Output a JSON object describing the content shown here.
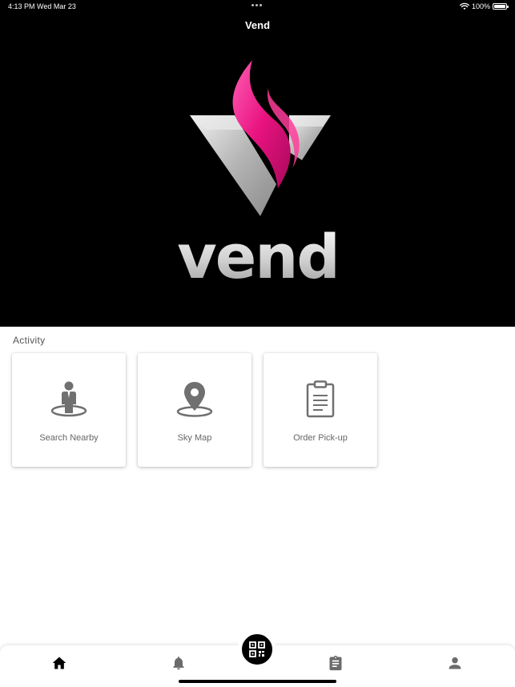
{
  "status_bar": {
    "time": "4:13 PM",
    "date": "Wed Mar 23",
    "battery": "100%",
    "battery_level": 1.0
  },
  "app": {
    "title": "Vend",
    "logo_text": "vend",
    "brand_colors": {
      "accent": "#e8127f",
      "silver": "#c8c8c8",
      "background": "#000000"
    }
  },
  "activity": {
    "title": "Activity",
    "cards": [
      {
        "label": "Search Nearby",
        "icon": "person-location-icon"
      },
      {
        "label": "Sky Map",
        "icon": "map-pin-icon"
      },
      {
        "label": "Order Pick-up",
        "icon": "clipboard-icon"
      }
    ]
  },
  "bottom_nav": {
    "items": [
      {
        "name": "home",
        "icon": "home-icon",
        "active": true
      },
      {
        "name": "notifications",
        "icon": "bell-icon",
        "active": false
      },
      {
        "name": "scan",
        "icon": "qr-code-icon",
        "active": false
      },
      {
        "name": "orders",
        "icon": "clipboard-icon",
        "active": false
      },
      {
        "name": "profile",
        "icon": "person-icon",
        "active": false
      }
    ]
  }
}
